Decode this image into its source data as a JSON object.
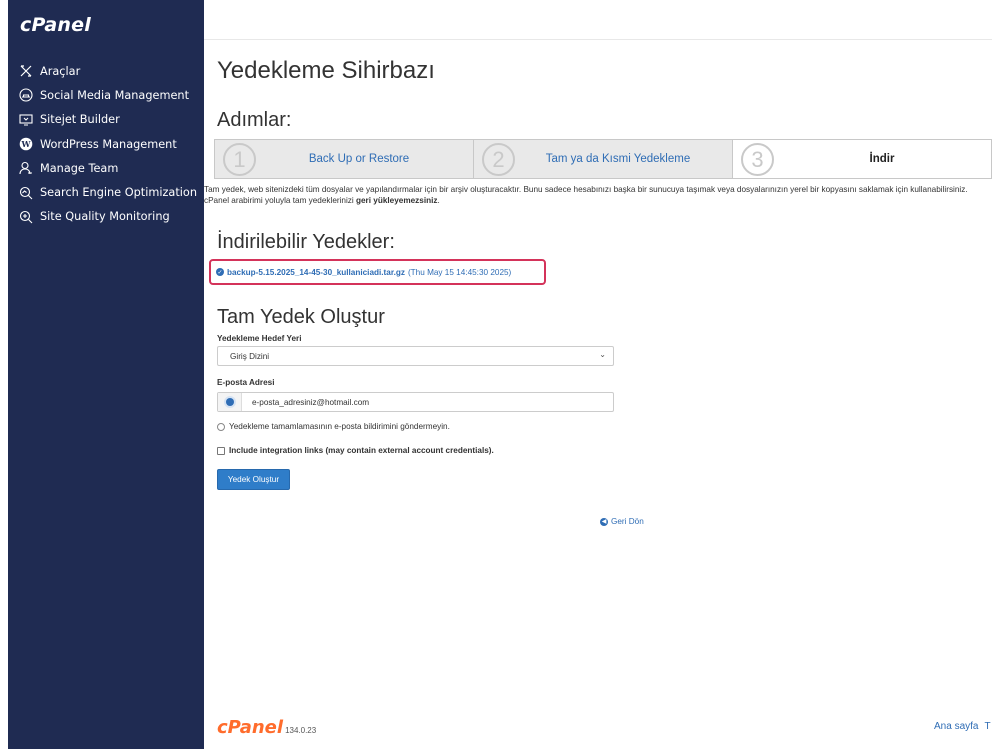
{
  "sidebar": {
    "logo": "cPanel",
    "items": [
      {
        "label": "Araçlar",
        "icon": "tools-icon"
      },
      {
        "label": "Social Media Management",
        "icon": "social-media-icon"
      },
      {
        "label": "Sitejet Builder",
        "icon": "sitejet-icon"
      },
      {
        "label": "WordPress Management",
        "icon": "wordpress-icon"
      },
      {
        "label": "Manage Team",
        "icon": "team-icon"
      },
      {
        "label": "Search Engine Optimization",
        "icon": "seo-icon"
      },
      {
        "label": "Site Quality Monitoring",
        "icon": "monitoring-icon"
      }
    ]
  },
  "main": {
    "title": "Yedekleme Sihirbazı",
    "steps_heading": "Adımlar:",
    "steps": [
      {
        "num": "1",
        "label": "Back Up or Restore"
      },
      {
        "num": "2",
        "label": "Tam ya da Kısmi Yedekleme"
      },
      {
        "num": "3",
        "label": "İndir"
      }
    ],
    "description_1": "Tam yedek, web sitenizdeki tüm dosyalar ve yapılandırmalar için bir arşiv oluşturacaktır. Bunu sadece hesabınızı başka bir sunucuya taşımak veya dosyalarınızın yerel bir kopyasını saklamak için kullanabilirsiniz. cPanel arabirimi yoluyla tam yedeklerinizi ",
    "description_bold": "geri yükleyemezsiniz",
    "description_end": ".",
    "downloads_heading": "İndirilebilir Yedekler:",
    "backup_file": "backup-5.15.2025_14-45-30_kullaniciadi.tar.gz",
    "backup_date": "(Thu May 15 14:45:30 2025)",
    "create_heading": "Tam Yedek Oluştur",
    "destination_label": "Yedekleme Hedef Yeri",
    "destination_value": "Giriş Dizini",
    "email_label": "E-posta Adresi",
    "email_value": "e-posta_adresiniz@hotmail.com",
    "no_email_option": "Yedekleme tamamlamasının e-posta bildirimini göndermeyin.",
    "integration_option": "Include integration links (may contain external account credentials).",
    "submit_label": "Yedek Oluştur",
    "back_label": "Geri Dön"
  },
  "footer": {
    "brand": "cPanel",
    "version": "134.0.23",
    "home_link": "Ana sayfa",
    "next_link_fragment": "T"
  },
  "colors": {
    "sidebar_bg": "#1f2b52",
    "link": "#2f6db5",
    "highlight_border": "#d4335a",
    "button": "#2f7dc9",
    "brand_orange": "#ff6c2c"
  }
}
